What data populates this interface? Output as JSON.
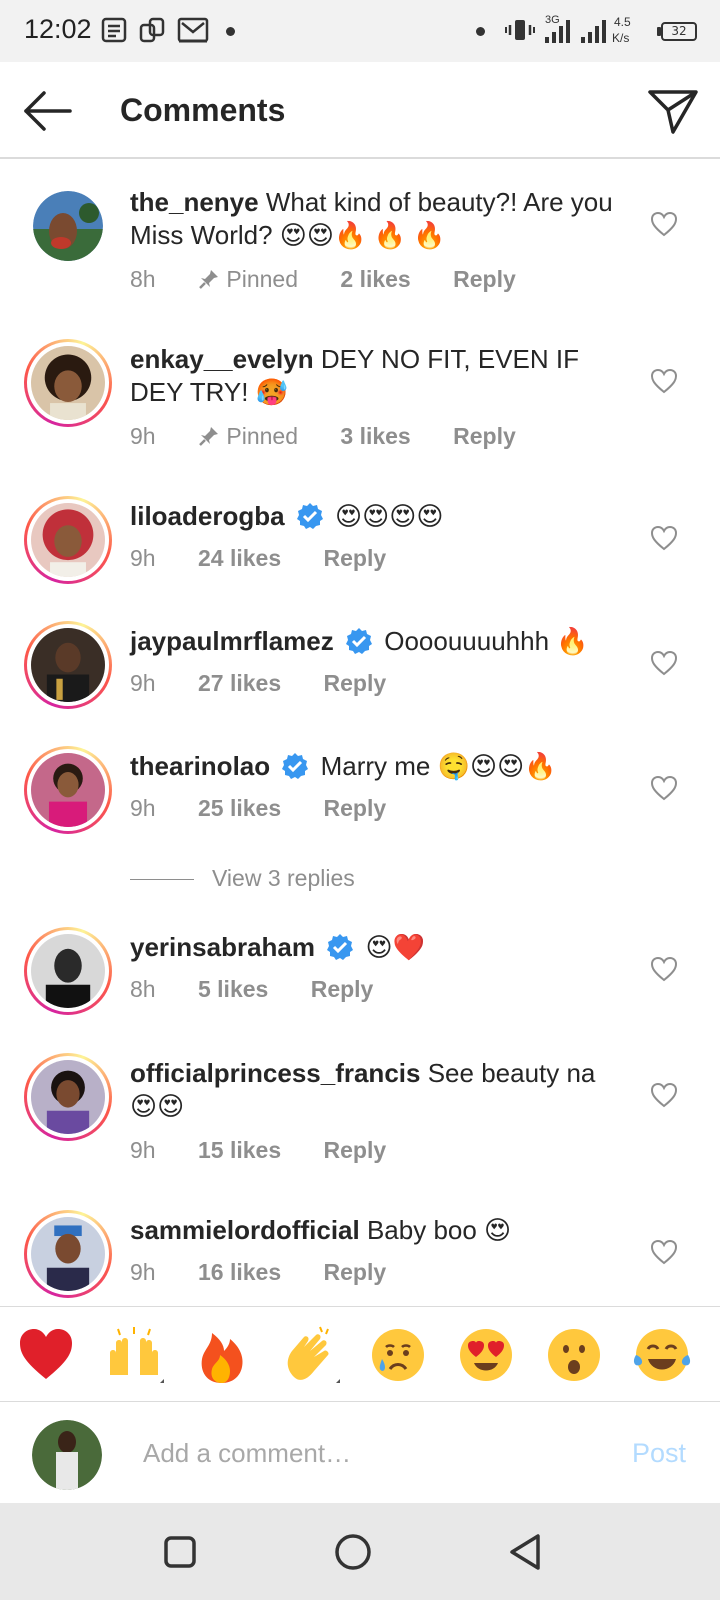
{
  "status_bar": {
    "time": "12:02",
    "network_type": "3G",
    "speed_value": "4.5",
    "speed_unit": "K/s",
    "battery": "32",
    "icons": [
      "news-icon",
      "sync-icon",
      "gmail-icon",
      "notification-dot",
      "vibrate-icon",
      "signal-icon",
      "signal-icon",
      "battery-icon"
    ]
  },
  "header": {
    "title": "Comments",
    "back_icon": "arrow-left-icon",
    "send_icon": "send-icon"
  },
  "comments": [
    {
      "username": "the_nenye",
      "verified": false,
      "text": "What kind of beauty?! Are you Miss World? 😍😍🔥 🔥 🔥",
      "time": "8h",
      "pinned": "Pinned",
      "likes": "2 likes",
      "reply": "Reply",
      "story_ring": false
    },
    {
      "username": "enkay__evelyn",
      "verified": false,
      "text": "DEY NO FIT, EVEN IF DEY TRY! 🥵",
      "time": "9h",
      "pinned": "Pinned",
      "likes": "3 likes",
      "reply": "Reply",
      "story_ring": true
    },
    {
      "username": "liloaderogba",
      "verified": true,
      "text": "😍😍😍😍",
      "time": "9h",
      "likes": "24 likes",
      "reply": "Reply",
      "story_ring": true
    },
    {
      "username": "jaypaulmrflamez",
      "verified": true,
      "text": "Oooouuuuhhh 🔥",
      "time": "9h",
      "likes": "27 likes",
      "reply": "Reply",
      "story_ring": true
    },
    {
      "username": "thearinolao",
      "verified": true,
      "text": "Marry me 🤤😍😍🔥",
      "time": "9h",
      "likes": "25 likes",
      "reply": "Reply",
      "story_ring": true
    },
    {
      "username": "yerinsabraham",
      "verified": true,
      "text": "😍❤️",
      "time": "8h",
      "likes": "5 likes",
      "reply": "Reply",
      "story_ring": true
    },
    {
      "username": "officialprincess_francis",
      "verified": false,
      "text": "See beauty na 😍😍",
      "time": "9h",
      "likes": "15 likes",
      "reply": "Reply",
      "story_ring": true
    },
    {
      "username": "sammielordofficial",
      "verified": false,
      "text": "Baby boo 😍",
      "time": "9h",
      "likes": "16 likes",
      "reply": "Reply",
      "story_ring": true
    }
  ],
  "view_replies": "View 3 replies",
  "quick_reactions": [
    "❤️",
    "🙌",
    "🔥",
    "👏",
    "😢",
    "😍",
    "😮",
    "😂"
  ],
  "composer": {
    "placeholder": "Add a comment…",
    "post_label": "Post"
  },
  "nav": {
    "icons": [
      "recents-square-icon",
      "home-circle-icon",
      "back-triangle-icon"
    ]
  },
  "colors": {
    "accent": "#0095f6",
    "post_disabled": "#b3dbff",
    "muted": "#8e8e8e",
    "text": "#262626",
    "heart": "#ed4956"
  }
}
